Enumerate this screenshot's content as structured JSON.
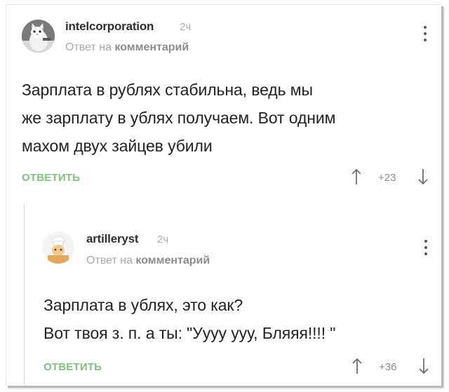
{
  "comments": [
    {
      "username": "intelcorporation",
      "time": "2ч",
      "reply_prefix": "Ответ на",
      "reply_target": "комментарий",
      "lines": [
        "Зарплата в рублях стабильна, ведь мы",
        "же зарплату в ублях получаем. Вот одним",
        "махом двух зайцев убили"
      ],
      "reply_label": "ОТВЕТИТЬ",
      "score": "+23",
      "avatar_icon": "cat-avatar-icon"
    },
    {
      "username": "artilleryst",
      "time": "2ч",
      "reply_prefix": "Ответ на",
      "reply_target": "комментарий",
      "lines": [
        "Зарплата в ублях, это как?",
        "Вот твоя з. п. а ты: \"Уууу ууу, Бляяя!!!! \""
      ],
      "reply_label": "ОТВЕТИТЬ",
      "score": "+36",
      "avatar_icon": "chef-avatar-icon"
    }
  ],
  "colors": {
    "accent_green": "#7ec27e",
    "meta_gray": "#a7a7a7",
    "text_dark": "#222222"
  },
  "icons": [
    "kebab-menu-icon",
    "arrow-up-icon",
    "arrow-down-icon"
  ]
}
